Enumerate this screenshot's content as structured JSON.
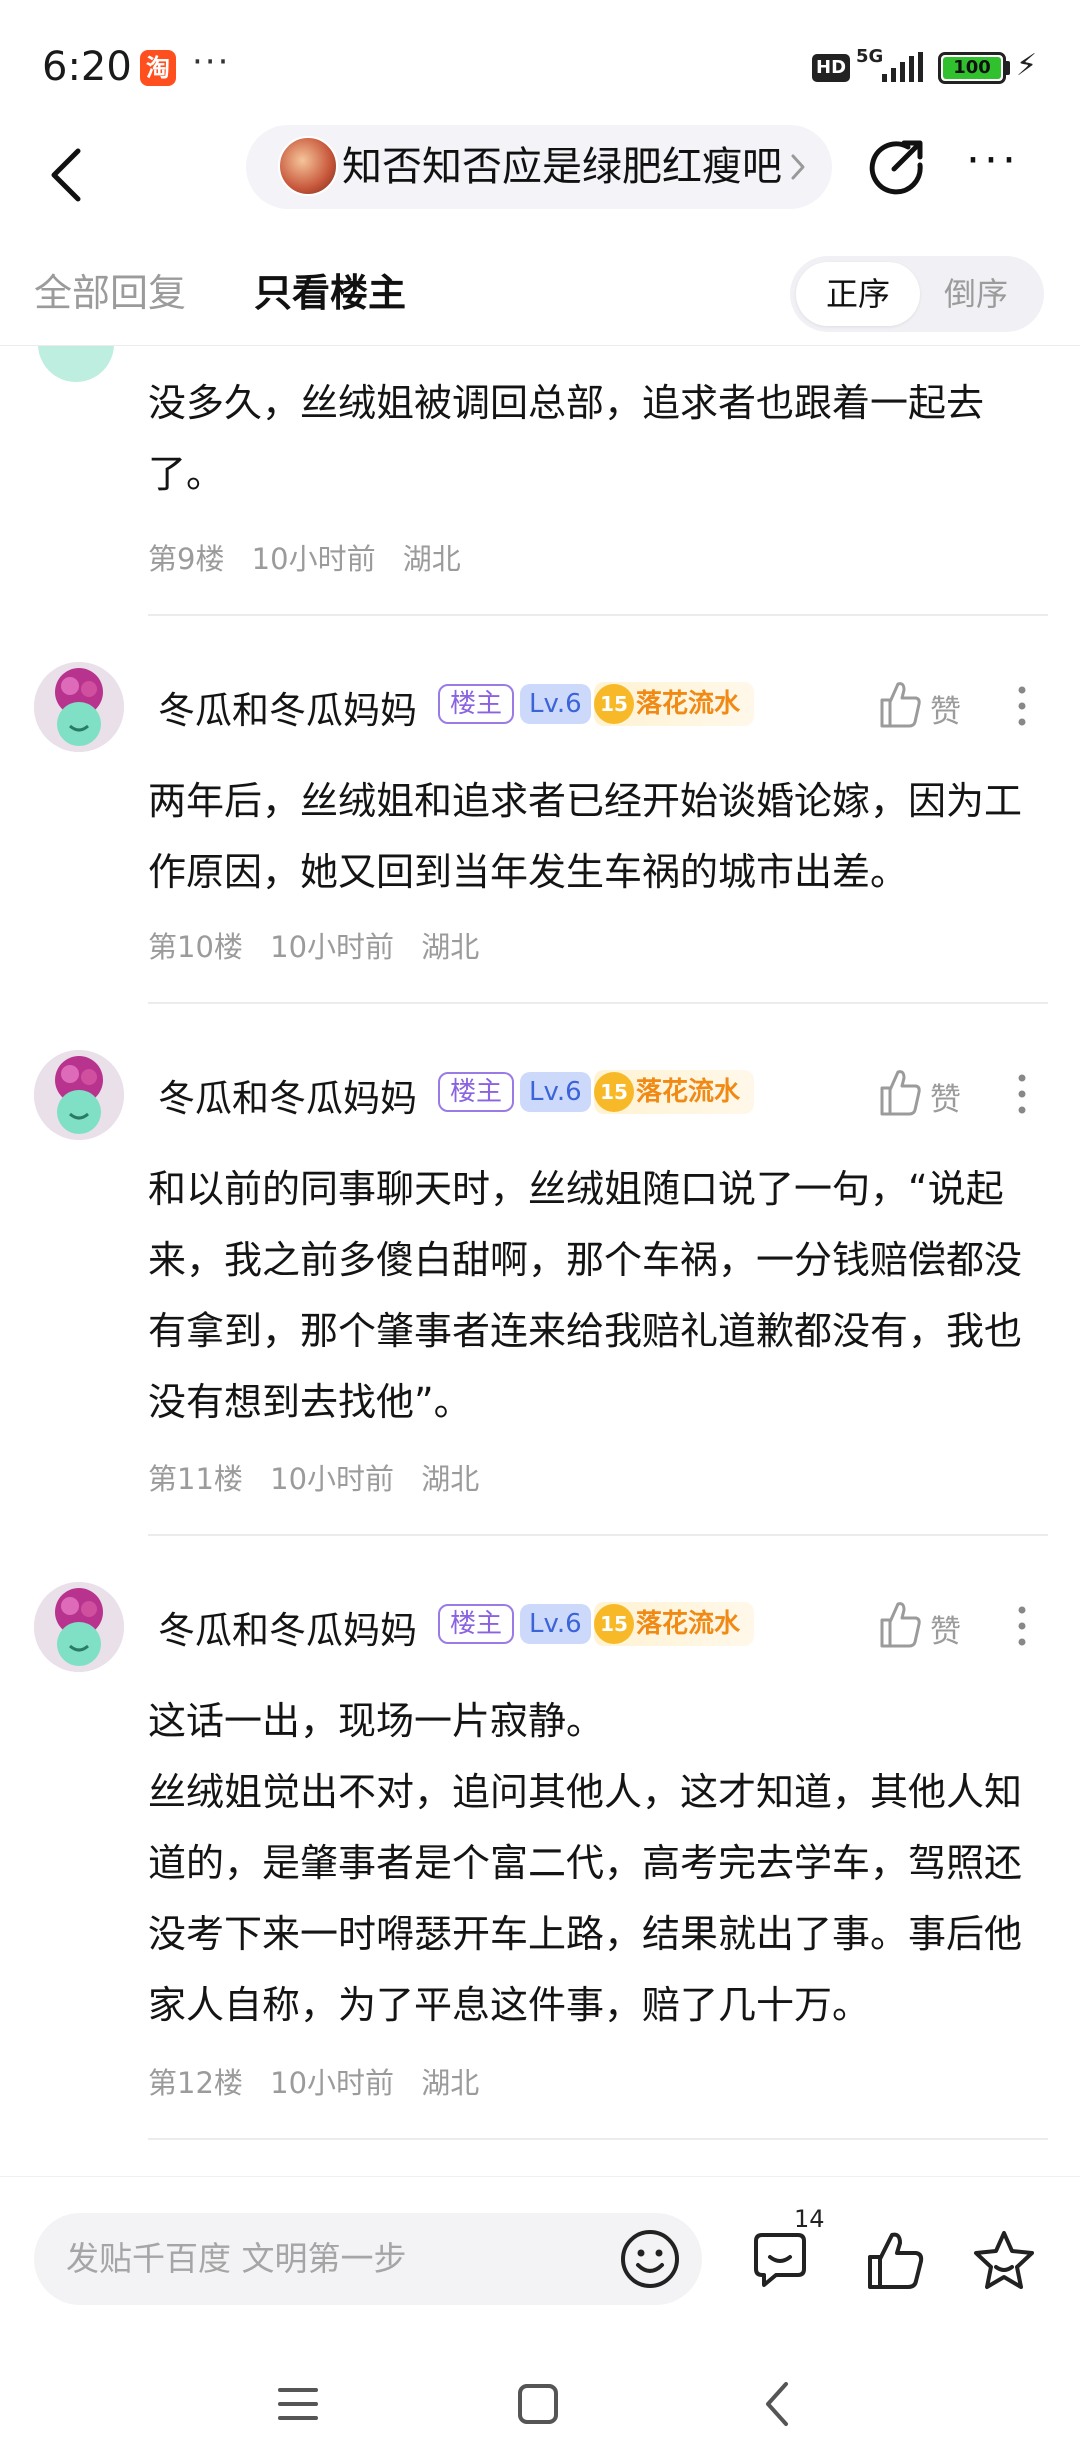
{
  "status_bar": {
    "time": "6:20",
    "taobao_label": "淘",
    "more": "···",
    "hd": "HD",
    "network": "5G",
    "battery": "100",
    "icons": [
      "taobao-app-icon",
      "hd-icon",
      "signal-icon",
      "battery-icon",
      "charging-icon"
    ]
  },
  "nav": {
    "forum_name": "知否知否应是绿肥红瘦吧",
    "more": "···",
    "icons": [
      "back-icon",
      "chevron-right-icon",
      "share-icon",
      "more-icon"
    ]
  },
  "tabs": {
    "all_replies": "全部回复",
    "only_op": "只看楼主",
    "sort_asc": "正序",
    "sort_desc": "倒序"
  },
  "posts": [
    {
      "partial": true,
      "content": "没多久，丝绒姐被调回总部，追求者也跟着一起去了。",
      "floor": "第9楼",
      "time": "10小时前",
      "location": "湖北"
    },
    {
      "author": "冬瓜和冬瓜妈妈",
      "op_badge": "楼主",
      "level": "Lv.6",
      "honor_level": "15",
      "honor_title": "落花流水",
      "like_label": "赞",
      "content": "两年后，丝绒姐和追求者已经开始谈婚论嫁，因为工作原因，她又回到当年发生车祸的城市出差。",
      "floor": "第10楼",
      "time": "10小时前",
      "location": "湖北"
    },
    {
      "author": "冬瓜和冬瓜妈妈",
      "op_badge": "楼主",
      "level": "Lv.6",
      "honor_level": "15",
      "honor_title": "落花流水",
      "like_label": "赞",
      "content": "和以前的同事聊天时，丝绒姐随口说了一句，“说起来，我之前多傻白甜啊，那个车祸，一分钱赔偿都没有拿到，那个肇事者连来给我赔礼道歉都没有，我也没有想到去找他”。",
      "floor": "第11楼",
      "time": "10小时前",
      "location": "湖北"
    },
    {
      "author": "冬瓜和冬瓜妈妈",
      "op_badge": "楼主",
      "level": "Lv.6",
      "honor_level": "15",
      "honor_title": "落花流水",
      "like_label": "赞",
      "content_p1": "这话一出，现场一片寂静。",
      "content_p2": "丝绒姐觉出不对，追问其他人，这才知道，其他人知道的，是肇事者是个富二代，高考完去学车，驾照还没考下来一时嘚瑟开车上路，结果就出了事。事后他家人自称，为了平息这件事，赔了几十万。",
      "floor": "第12楼",
      "time": "10小时前",
      "location": "湖北"
    }
  ],
  "bottom_bar": {
    "placeholder": "发贴千百度 文明第一步",
    "comment_count": "14",
    "icons": [
      "emoji-icon",
      "comment-icon",
      "thumbs-up-icon",
      "star-icon"
    ]
  },
  "colors": {
    "accent_purple": "#8a63e0",
    "level_blue": "#3b64d8",
    "honor_orange": "#f08a14",
    "meta_gray": "#9b9b9b"
  }
}
